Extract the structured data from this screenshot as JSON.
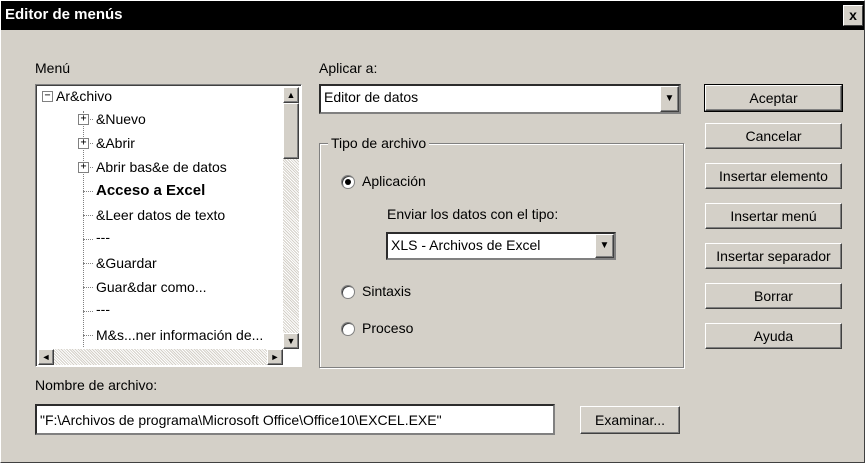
{
  "window": {
    "title": "Editor de menús",
    "close_glyph": "x"
  },
  "menu": {
    "label": "Menú",
    "tree": [
      {
        "label": "Ar&chivo",
        "expander": "−"
      },
      {
        "label": "&Nuevo",
        "expander": "+"
      },
      {
        "label": "&Abrir",
        "expander": "+"
      },
      {
        "label": "Abrir bas&e de datos",
        "expander": "+"
      },
      {
        "label": "Acceso a Excel"
      },
      {
        "label": "&Leer datos de texto"
      },
      {
        "label": "---"
      },
      {
        "label": "&Guardar"
      },
      {
        "label": "Guar&dar como..."
      },
      {
        "label": "---"
      },
      {
        "label": "M&s...ner información de..."
      }
    ]
  },
  "apply": {
    "label": "Aplicar a:",
    "value": "Editor de datos"
  },
  "file_type": {
    "legend": "Tipo de archivo",
    "options": [
      {
        "label": "Aplicación",
        "selected": true
      },
      {
        "label": "Sintaxis",
        "selected": false
      },
      {
        "label": "Proceso",
        "selected": false
      }
    ],
    "send_label": "Enviar los datos con el tipo:",
    "send_value": "XLS - Archivos de Excel"
  },
  "buttons": {
    "accept": "Aceptar",
    "cancel": "Cancelar",
    "insert_item": "Insertar elemento",
    "insert_menu": "Insertar menú",
    "insert_separator": "Insertar separador",
    "delete": "Borrar",
    "help": "Ayuda",
    "browse": "Examinar..."
  },
  "filename": {
    "label": "Nombre de archivo:",
    "value": "\"F:\\Archivos de programa\\Microsoft Office\\Office10\\EXCEL.EXE\""
  },
  "icons": {
    "scroll_up": "▲",
    "scroll_down": "▼",
    "scroll_left": "◄",
    "scroll_right": "►",
    "dropdown": "▼"
  }
}
